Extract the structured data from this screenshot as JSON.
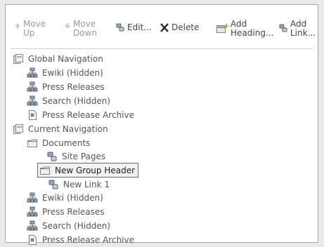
{
  "toolbar": {
    "move_up": "Move\nUp",
    "move_down": "Move\nDown",
    "edit": "Edit...",
    "delete": "Delete",
    "add_heading": "Add\nHeading...",
    "add_link": "Add\nLink..."
  },
  "tree": [
    {
      "label": "Global Navigation",
      "icon": "navigation-root-icon",
      "level": 0
    },
    {
      "label": "Ewiki (Hidden)",
      "icon": "site-icon",
      "level": 1
    },
    {
      "label": "Press Releases",
      "icon": "site-icon",
      "level": 1
    },
    {
      "label": "Search (Hidden)",
      "icon": "site-icon",
      "level": 1
    },
    {
      "label": "Press Release Archive",
      "icon": "page-icon",
      "level": 1
    },
    {
      "label": "Current Navigation",
      "icon": "navigation-root-icon",
      "level": 0
    },
    {
      "label": "Documents",
      "icon": "folder-icon",
      "level": 1
    },
    {
      "label": "Site Pages",
      "icon": "link-icon",
      "level": 2
    },
    {
      "label": "New Group Header",
      "icon": "folder-icon",
      "level": 1,
      "selected": true
    },
    {
      "label": "New Link 1",
      "icon": "link-icon",
      "level": 2
    },
    {
      "label": "Ewiki (Hidden)",
      "icon": "site-icon",
      "level": 1
    },
    {
      "label": "Press Releases",
      "icon": "site-icon",
      "level": 1
    },
    {
      "label": "Search (Hidden)",
      "icon": "site-icon",
      "level": 1
    },
    {
      "label": "Press Release Archive",
      "icon": "page-icon",
      "level": 1
    }
  ]
}
